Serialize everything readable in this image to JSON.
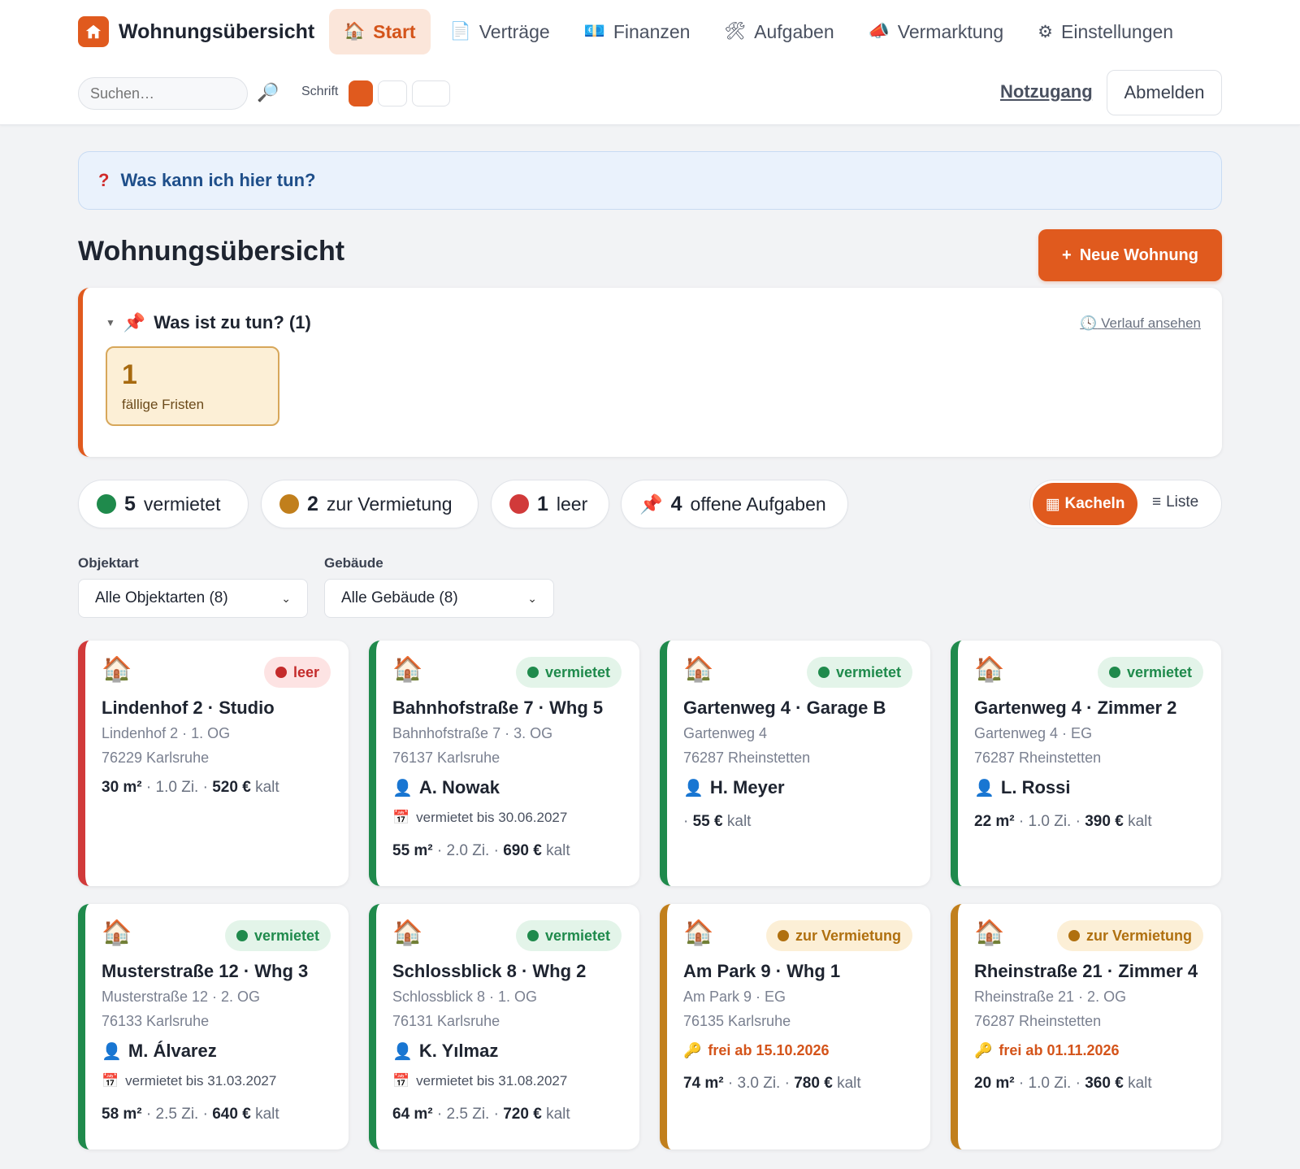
{
  "colors": {
    "accent": "#e05a1e",
    "green": "#1f8a4c",
    "amber": "#c17f1c",
    "red": "#d13a3a"
  },
  "header": {
    "app_title": "Wohnungsübersicht",
    "nav": [
      {
        "label": "Start",
        "icon": "house-icon",
        "active": true
      },
      {
        "label": "Verträge",
        "icon": "document-icon"
      },
      {
        "label": "Finanzen",
        "icon": "money-icon"
      },
      {
        "label": "Aufgaben",
        "icon": "tools-icon"
      },
      {
        "label": "Vermarktung",
        "icon": "megaphone-icon"
      },
      {
        "label": "Einstellungen",
        "icon": "gear-icon"
      }
    ],
    "search_placeholder": "Suchen…",
    "font_label": "Schrift",
    "emergency_link": "Notzugang",
    "logout": "Abmelden"
  },
  "help": {
    "text": "Was kann ich hier tun?",
    "icon": "?"
  },
  "page": {
    "title": "Wohnungsübersicht",
    "new_button": "Neue Wohnung",
    "new_button_icon": "+"
  },
  "todo": {
    "title": "Was ist zu tun? (1)",
    "history_link": "Verlauf ansehen",
    "due_count": "1",
    "due_label": "fällige Fristen"
  },
  "stats": [
    {
      "count": "5",
      "label": "vermietet",
      "color": "#1f8a4c"
    },
    {
      "count": "2",
      "label": "zur Vermietung",
      "color": "#c17f1c"
    },
    {
      "count": "1",
      "label": "leer",
      "color": "#d13a3a"
    },
    {
      "count": "4",
      "label": "offene Aufgaben",
      "icon": "pin-icon"
    }
  ],
  "view_toggle": {
    "tiles": "Kacheln",
    "list": "Liste",
    "selected": "Kacheln"
  },
  "filters": {
    "type_label": "Objektart",
    "type_value": "Alle Objektarten (8)",
    "building_label": "Gebäude",
    "building_value": "Alle Gebäude (8)"
  },
  "units": [
    {
      "title": "Lindenhof 2 · Studio",
      "addr1": "Lindenhof 2 · 1. OG",
      "addr2": "76229 Karlsruhe",
      "status": "leer",
      "tenant": "",
      "lease": "",
      "free": "",
      "area": "30 m²",
      "rooms": "1.0 Zi.",
      "rent": "520 €",
      "rent_suffix": "kalt"
    },
    {
      "title": "Bahnhofstraße 7 · Whg 5",
      "addr1": "Bahnhofstraße 7 · 3. OG",
      "addr2": "76137 Karlsruhe",
      "status": "vermietet",
      "tenant": "A. Nowak",
      "lease": "vermietet bis 30.06.2027",
      "free": "",
      "area": "55 m²",
      "rooms": "2.0 Zi.",
      "rent": "690 €",
      "rent_suffix": "kalt"
    },
    {
      "title": "Gartenweg 4 · Garage B",
      "addr1": "Gartenweg 4",
      "addr2": "76287 Rheinstetten",
      "status": "vermietet",
      "tenant": "H. Meyer",
      "lease": "",
      "free": "",
      "area": "",
      "rooms": "",
      "rent": "55 €",
      "rent_suffix": "kalt"
    },
    {
      "title": "Gartenweg 4 · Zimmer 2",
      "addr1": "Gartenweg 4 · EG",
      "addr2": "76287 Rheinstetten",
      "status": "vermietet",
      "tenant": "L. Rossi",
      "lease": "",
      "free": "",
      "area": "22 m²",
      "rooms": "1.0 Zi.",
      "rent": "390 €",
      "rent_suffix": "kalt"
    },
    {
      "title": "Musterstraße 12 · Whg 3",
      "addr1": "Musterstraße 12 · 2. OG",
      "addr2": "76133 Karlsruhe",
      "status": "vermietet",
      "tenant": "M. Álvarez",
      "lease": "vermietet bis 31.03.2027",
      "free": "",
      "area": "58 m²",
      "rooms": "2.5 Zi.",
      "rent": "640 €",
      "rent_suffix": "kalt"
    },
    {
      "title": "Schlossblick 8 · Whg 2",
      "addr1": "Schlossblick 8 · 1. OG",
      "addr2": "76131 Karlsruhe",
      "status": "vermietet",
      "tenant": "K. Yılmaz",
      "lease": "vermietet bis 31.08.2027",
      "free": "",
      "area": "64 m²",
      "rooms": "2.5 Zi.",
      "rent": "720 €",
      "rent_suffix": "kalt"
    },
    {
      "title": "Am Park 9 · Whg 1",
      "addr1": "Am Park 9 · EG",
      "addr2": "76135 Karlsruhe",
      "status": "zur Vermietung",
      "tenant": "",
      "lease": "",
      "free": "frei ab 15.10.2026",
      "area": "74 m²",
      "rooms": "3.0 Zi.",
      "rent": "780 €",
      "rent_suffix": "kalt"
    },
    {
      "title": "Rheinstraße 21 · Zimmer 4",
      "addr1": "Rheinstraße 21 · 2. OG",
      "addr2": "76287 Rheinstetten",
      "status": "zur Vermietung",
      "tenant": "",
      "lease": "",
      "free": "frei ab 01.11.2026",
      "area": "20 m²",
      "rooms": "1.0 Zi.",
      "rent": "360 €",
      "rent_suffix": "kalt"
    }
  ]
}
